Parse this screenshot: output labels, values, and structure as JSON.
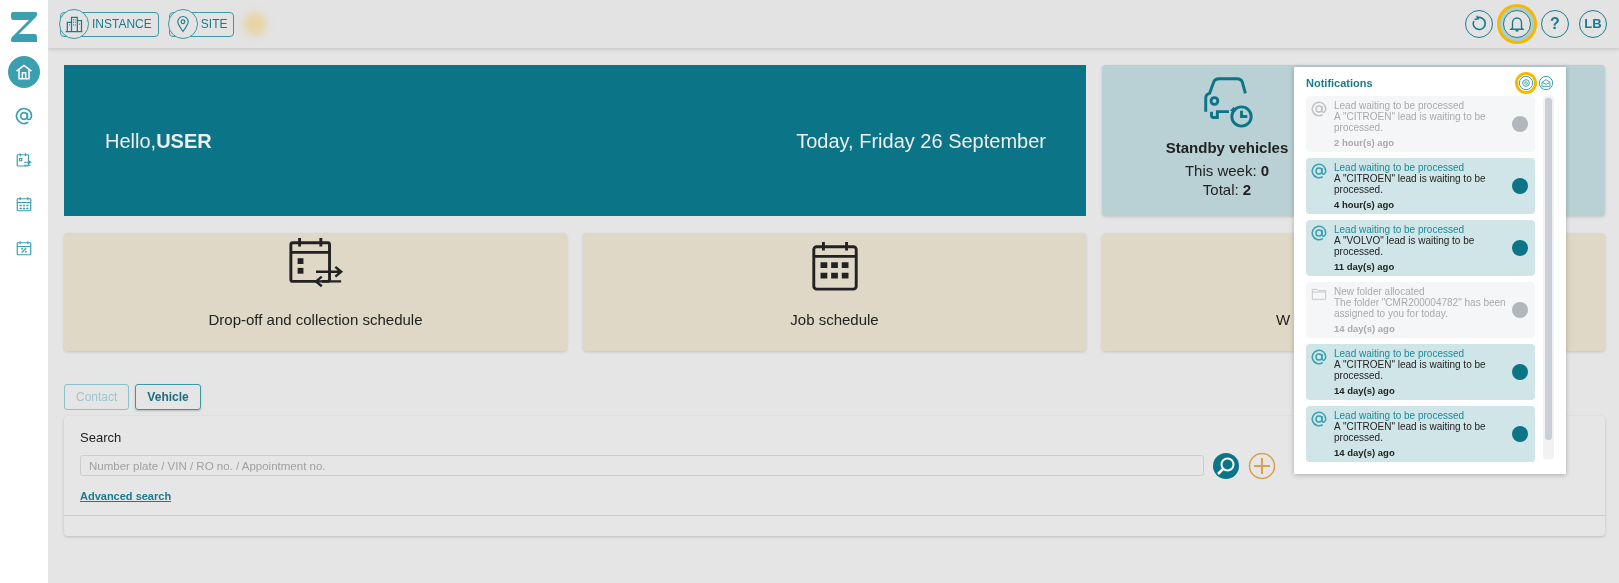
{
  "sidebar": {
    "items": [
      {
        "kind": "home",
        "selected": true
      },
      {
        "kind": "at",
        "selected": false
      },
      {
        "kind": "cal-swap",
        "selected": false
      },
      {
        "kind": "cal-grid",
        "selected": false
      },
      {
        "kind": "cal-percent",
        "selected": false
      }
    ]
  },
  "header": {
    "context_buttons": [
      {
        "kind": "building",
        "label": "INSTANCE"
      },
      {
        "kind": "pin",
        "label": "SITE"
      }
    ],
    "actions": [
      {
        "kind": "reload",
        "highlighted": false
      },
      {
        "kind": "bell",
        "highlighted": true
      },
      {
        "kind": "help",
        "label": "?",
        "highlighted": false
      },
      {
        "kind": "avatar",
        "label": "LB",
        "highlighted": false
      }
    ]
  },
  "greeting": {
    "prefix": "Hello,",
    "name": "USER",
    "date": "Today, Friday 26 September"
  },
  "standby": {
    "title": "Standby vehicles",
    "stats": [
      {
        "label": "This week: ",
        "value": "0"
      },
      {
        "label": "Total: ",
        "value": "2"
      }
    ]
  },
  "tiles": [
    {
      "kind": "dropoff",
      "label": "Drop-off and collection schedule"
    },
    {
      "kind": "job",
      "label": "Job schedule"
    },
    {
      "kind": "covered",
      "label": "W"
    }
  ],
  "tabs": [
    {
      "label": "Contact",
      "selected": false
    },
    {
      "label": "Vehicle",
      "selected": true
    }
  ],
  "search": {
    "label": "Search",
    "placeholder": "Number plate / VIN / RO no. / Appointment no.",
    "link": "Advanced search"
  },
  "notifications": {
    "title": "Notifications",
    "settings_highlighted": true,
    "items": [
      {
        "kind": "at",
        "read": true,
        "title": "Lead waiting to be processed",
        "body": "A \"CITROEN\" lead is waiting to be processed.",
        "time": "2 hour(s) ago"
      },
      {
        "kind": "at",
        "read": false,
        "title": "Lead waiting to be processed",
        "body": "A \"CITROEN\" lead is waiting to be processed.",
        "time": "4 hour(s) ago"
      },
      {
        "kind": "at",
        "read": false,
        "title": "Lead waiting to be processed",
        "body": "A \"VOLVO\" lead is waiting to be processed.",
        "time": "11 day(s) ago"
      },
      {
        "kind": "folder",
        "read": true,
        "title": "New folder allocated",
        "body": "The folder \"CMR200004782\" has been assigned to you for today.",
        "time": "14 day(s) ago"
      },
      {
        "kind": "at",
        "read": false,
        "title": "Lead waiting to be processed",
        "body": "A \"CITROEN\" lead is waiting to be processed.",
        "time": "14 day(s) ago"
      },
      {
        "kind": "at",
        "read": false,
        "title": "Lead waiting to be processed",
        "body": "A \"CITROEN\" lead is waiting to be processed.",
        "time": "14 day(s) ago"
      }
    ]
  }
}
